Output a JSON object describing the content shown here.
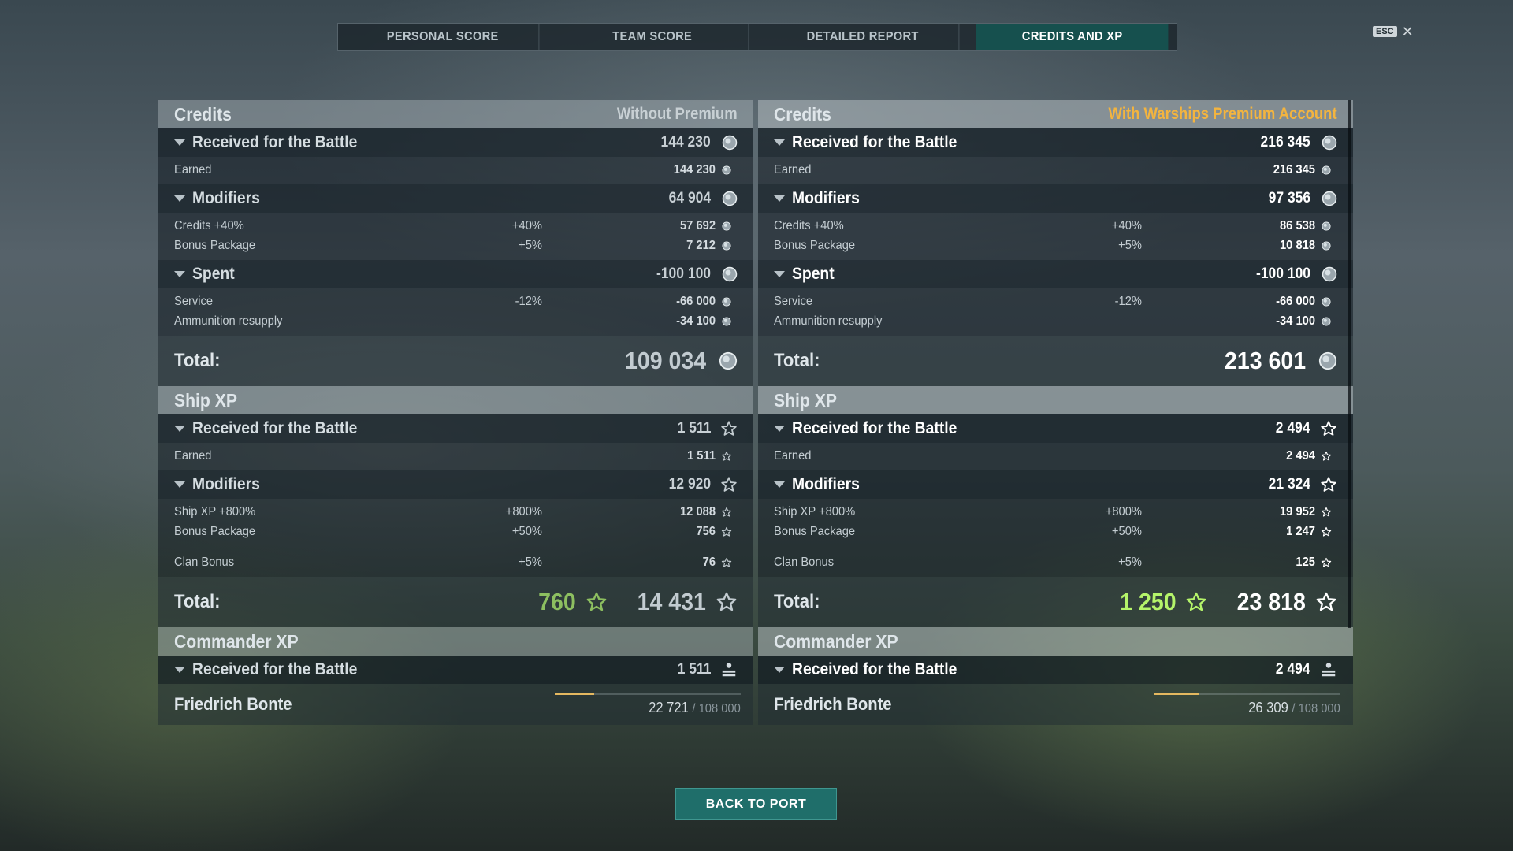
{
  "tabs": [
    "PERSONAL SCORE",
    "TEAM SCORE",
    "DETAILED REPORT",
    "CREDITS AND XP"
  ],
  "active_tab": "CREDITS AND XP",
  "esc": {
    "key": "ESC",
    "close": "✕"
  },
  "left": {
    "credits": {
      "title": "Credits",
      "subtitle": "Without Premium",
      "received": {
        "label": "Received for the Battle",
        "value": "144 230",
        "rows": [
          {
            "label": "Earned",
            "value": "144 230"
          }
        ]
      },
      "modifiers": {
        "label": "Modifiers",
        "value": "64 904",
        "rows": [
          {
            "label": "Credits +40%",
            "pct": "+40%",
            "value": "57 692"
          },
          {
            "label": "Bonus Package",
            "pct": "+5%",
            "value": "7 212"
          }
        ]
      },
      "spent": {
        "label": "Spent",
        "value": "-100 100",
        "rows": [
          {
            "label": "Service",
            "pct": "-12%",
            "value": "-66 000"
          },
          {
            "label": "Ammunition resupply",
            "value": "-34 100"
          }
        ]
      },
      "total_label": "Total:",
      "total": "109 034"
    },
    "shipxp": {
      "title": "Ship XP",
      "received": {
        "label": "Received for the Battle",
        "value": "1 511",
        "rows": [
          {
            "label": "Earned",
            "value": "1 511"
          }
        ]
      },
      "modifiers": {
        "label": "Modifiers",
        "value": "12 920",
        "rows": [
          {
            "label": "Ship XP +800%",
            "pct": "+800%",
            "value": "12 088"
          },
          {
            "label": "Bonus Package",
            "pct": "+50%",
            "value": "756"
          },
          {
            "label": "Clan Bonus",
            "pct": "+5%",
            "value": "76"
          }
        ]
      },
      "total_label": "Total:",
      "bonus": "760",
      "total": "14 431"
    },
    "commander": {
      "title": "Commander XP",
      "received": {
        "label": "Received for the Battle",
        "value": "1 511"
      },
      "name": "Friedrich Bonte",
      "xp": "22 721",
      "xp_max": "/ 108 000",
      "progress": 0.21
    }
  },
  "right": {
    "credits": {
      "title": "Credits",
      "subtitle": "With Warships Premium Account",
      "received": {
        "label": "Received for the Battle",
        "value": "216 345",
        "rows": [
          {
            "label": "Earned",
            "value": "216 345"
          }
        ]
      },
      "modifiers": {
        "label": "Modifiers",
        "value": "97 356",
        "rows": [
          {
            "label": "Credits +40%",
            "pct": "+40%",
            "value": "86 538"
          },
          {
            "label": "Bonus Package",
            "pct": "+5%",
            "value": "10 818"
          }
        ]
      },
      "spent": {
        "label": "Spent",
        "value": "-100 100",
        "rows": [
          {
            "label": "Service",
            "pct": "-12%",
            "value": "-66 000"
          },
          {
            "label": "Ammunition resupply",
            "value": "-34 100"
          }
        ]
      },
      "total_label": "Total:",
      "total": "213 601"
    },
    "shipxp": {
      "title": "Ship XP",
      "received": {
        "label": "Received for the Battle",
        "value": "2 494",
        "rows": [
          {
            "label": "Earned",
            "value": "2 494"
          }
        ]
      },
      "modifiers": {
        "label": "Modifiers",
        "value": "21 324",
        "rows": [
          {
            "label": "Ship XP +800%",
            "pct": "+800%",
            "value": "19 952"
          },
          {
            "label": "Bonus Package",
            "pct": "+50%",
            "value": "1 247"
          },
          {
            "label": "Clan Bonus",
            "pct": "+5%",
            "value": "125"
          }
        ]
      },
      "total_label": "Total:",
      "bonus": "1 250",
      "total": "23 818"
    },
    "commander": {
      "title": "Commander XP",
      "received": {
        "label": "Received for the Battle",
        "value": "2 494"
      },
      "name": "Friedrich Bonte",
      "xp": "26 309",
      "xp_max": "/ 108 000",
      "progress": 0.24
    }
  },
  "back_button": "BACK TO PORT",
  "colors": {
    "premium_gold": "#f3b43f",
    "bonus_green": "#b5f46a",
    "active_tab": "#16504e",
    "button": "#1f6e6a"
  },
  "icons": {
    "credits": "credit-coin-icon",
    "xp": "star-icon",
    "commander": "commander-icon",
    "expand": "caret-down-icon"
  }
}
